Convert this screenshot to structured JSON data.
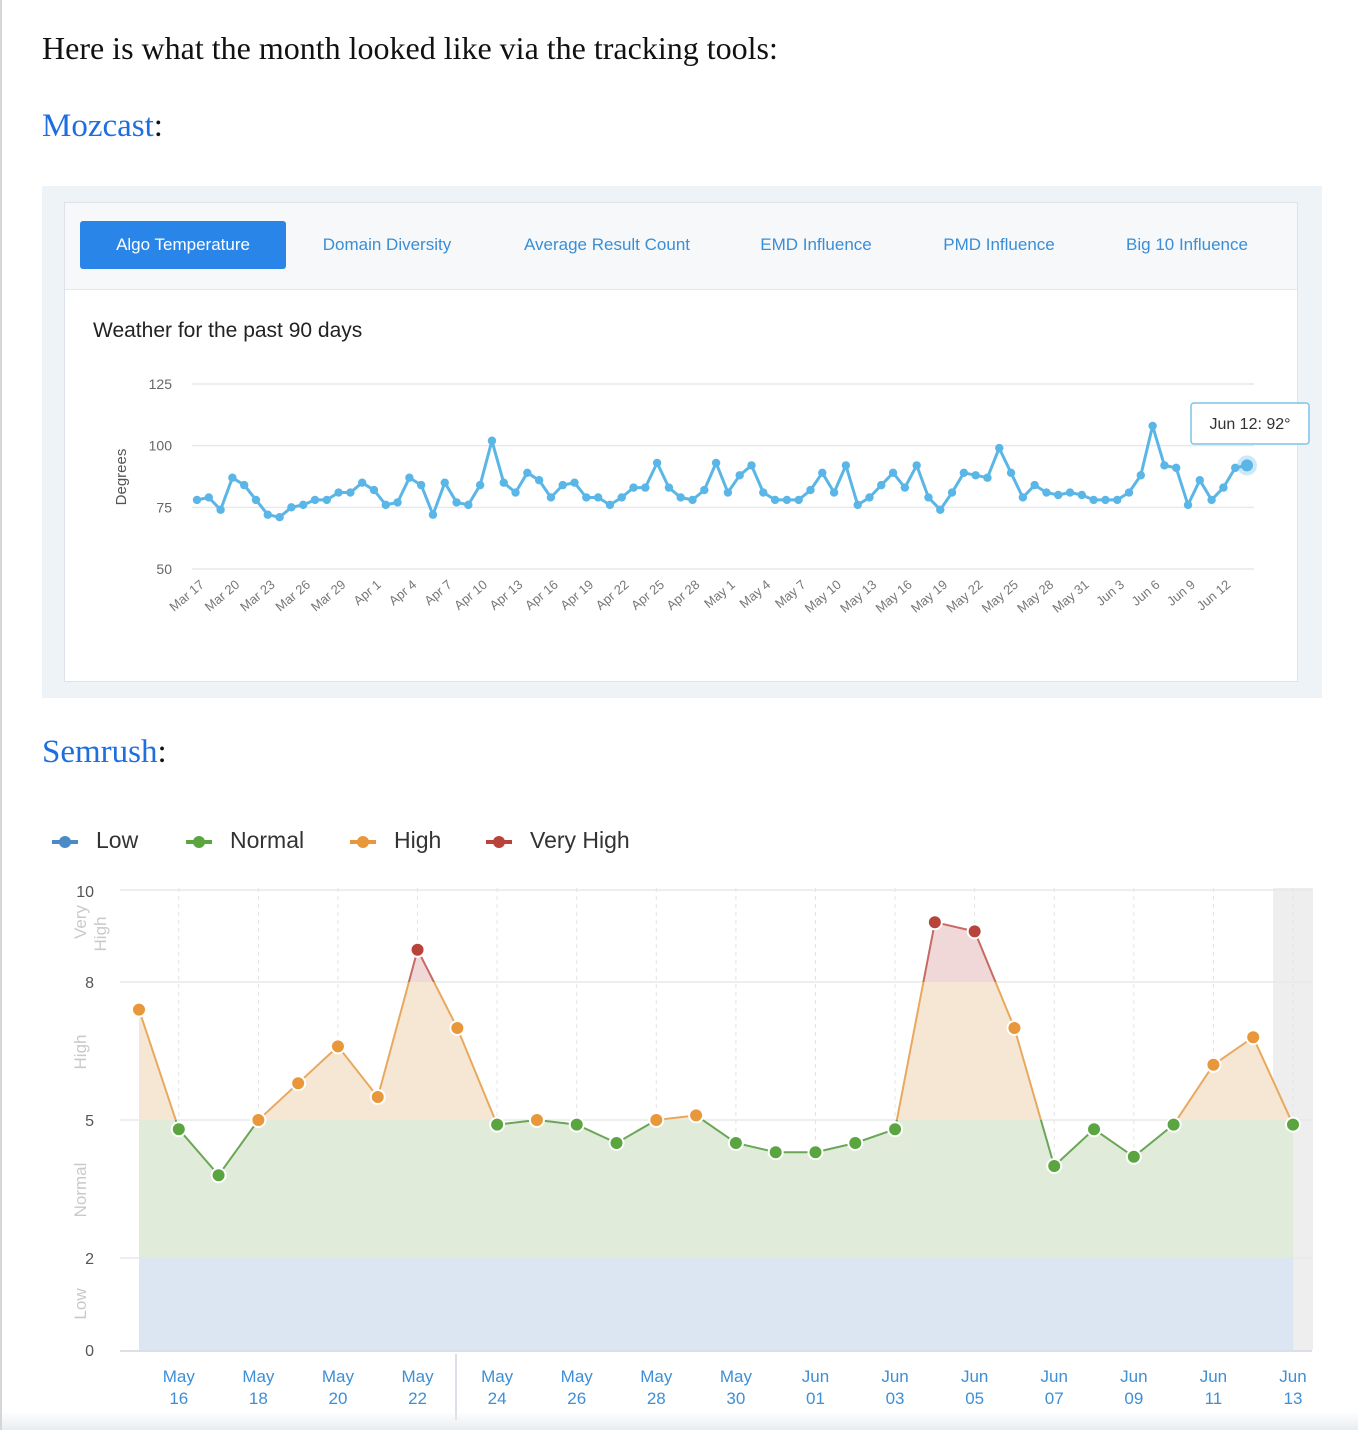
{
  "intro_text": "Here is what the month looked like via the tracking tools:",
  "mozcast": {
    "heading_link": "Mozcast",
    "heading_suffix": ":",
    "tabs": [
      "Algo Temperature",
      "Domain Diversity",
      "Average Result Count",
      "EMD Influence",
      "PMD Influence",
      "Big 10 Influence"
    ],
    "active_tab": "Algo Temperature",
    "title": "Weather for the past 90 days",
    "tooltip": "Jun 12: 92°",
    "line_color": "#5ab6e6"
  },
  "semrush": {
    "heading_link": "Semrush",
    "heading_suffix": ":",
    "legend": [
      {
        "label": "Low",
        "color": "#4a8ac7"
      },
      {
        "label": "Normal",
        "color": "#5aa540"
      },
      {
        "label": "High",
        "color": "#e8983a"
      },
      {
        "label": "Very High",
        "color": "#b8433a"
      }
    ],
    "band_labels": [
      "Very High",
      "High",
      "Normal",
      "Low"
    ]
  },
  "chart_data": [
    {
      "type": "line",
      "title": "Weather for the past 90 days",
      "ylabel": "Degrees",
      "ylim": [
        50,
        125
      ],
      "yticks": [
        50,
        75,
        100,
        125
      ],
      "grid": true,
      "x_tick_labels": [
        "Mar 17",
        "Mar 20",
        "Mar 23",
        "Mar 26",
        "Mar 29",
        "Apr 1",
        "Apr 4",
        "Apr 7",
        "Apr 10",
        "Apr 13",
        "Apr 16",
        "Apr 19",
        "Apr 22",
        "Apr 25",
        "Apr 28",
        "May 1",
        "May 4",
        "May 7",
        "May 10",
        "May 13",
        "May 16",
        "May 19",
        "May 22",
        "May 25",
        "May 28",
        "May 31",
        "Jun 3",
        "Jun 6",
        "Jun 9",
        "Jun 12"
      ],
      "series": [
        {
          "values": [
            78,
            79,
            74,
            87,
            84,
            78,
            72,
            71,
            75,
            76,
            78,
            78,
            81,
            81,
            85,
            82,
            76,
            77,
            87,
            84,
            72,
            85,
            77,
            76,
            84,
            102,
            85,
            81,
            89,
            86,
            79,
            84,
            85,
            79,
            79,
            76,
            79,
            83,
            83,
            93,
            83,
            79,
            78,
            82,
            93,
            81,
            88,
            92,
            81,
            78,
            78,
            78,
            82,
            89,
            81,
            92,
            76,
            79,
            84,
            89,
            83,
            92,
            79,
            74,
            81,
            89,
            88,
            87,
            99,
            89,
            79,
            84,
            81,
            80,
            81,
            80,
            78,
            78,
            78,
            81,
            88,
            108,
            92,
            91,
            76,
            86,
            78,
            83,
            91,
            92
          ]
        }
      ]
    },
    {
      "type": "area",
      "ylim": [
        0,
        10
      ],
      "yticks": [
        0,
        2,
        5,
        8,
        10
      ],
      "grid": true,
      "legend": "top-left",
      "x_tick_labels": [
        "May 16",
        "May 18",
        "May 20",
        "May 22",
        "May 24",
        "May 26",
        "May 28",
        "May 30",
        "Jun 01",
        "Jun 03",
        "Jun 05",
        "Jun 07",
        "Jun 09",
        "Jun 11",
        "Jun 13"
      ],
      "x": [
        "May 15",
        "May 16",
        "May 17",
        "May 18",
        "May 19",
        "May 20",
        "May 21",
        "May 22",
        "May 23",
        "May 24",
        "May 25",
        "May 26",
        "May 27",
        "May 28",
        "May 29",
        "May 30",
        "May 31",
        "Jun 01",
        "Jun 02",
        "Jun 03",
        "Jun 04",
        "Jun 05",
        "Jun 06",
        "Jun 07",
        "Jun 08",
        "Jun 09",
        "Jun 10",
        "Jun 11",
        "Jun 12",
        "Jun 13"
      ],
      "bands": [
        {
          "name": "Low",
          "range": [
            0,
            2
          ]
        },
        {
          "name": "Normal",
          "range": [
            2,
            5
          ]
        },
        {
          "name": "High",
          "range": [
            5,
            8
          ]
        },
        {
          "name": "Very High",
          "range": [
            8,
            10
          ]
        }
      ],
      "series": [
        {
          "values": [
            7.4,
            4.8,
            3.8,
            5.0,
            5.8,
            6.6,
            5.5,
            8.7,
            7.0,
            4.9,
            5.0,
            4.9,
            4.5,
            5.0,
            5.1,
            4.5,
            4.3,
            4.3,
            4.5,
            4.8,
            9.3,
            9.1,
            7.0,
            4.0,
            4.8,
            4.2,
            4.9,
            6.2,
            6.8,
            4.9
          ]
        }
      ]
    }
  ]
}
